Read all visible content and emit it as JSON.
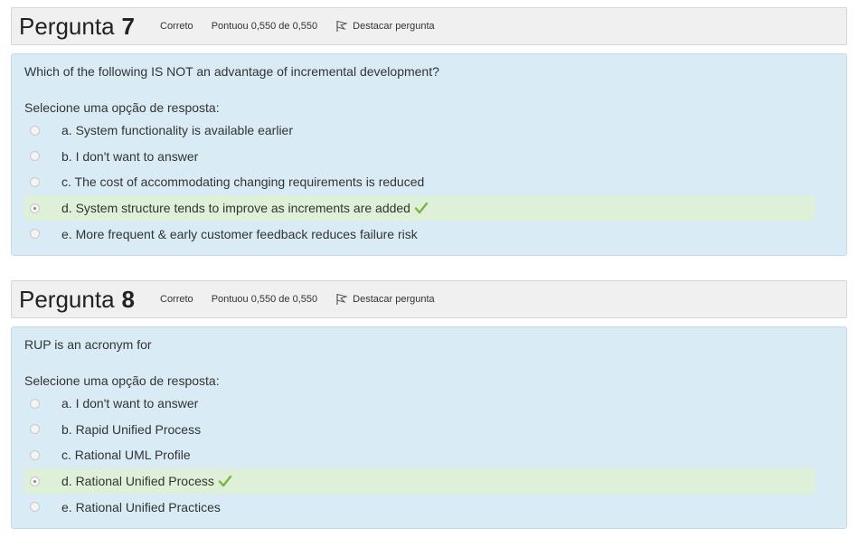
{
  "questions": [
    {
      "title": "Pergunta",
      "number": "7",
      "state": "Correto",
      "grade": "Pontuou 0,550 de 0,550",
      "flag_label": "Destacar pergunta",
      "text": "Which of the following IS NOT an advantage of incremental development?",
      "prompt": "Selecione uma opção de resposta:",
      "answers": [
        {
          "label": "a. System functionality is available earlier",
          "checked": false
        },
        {
          "label": "b. I don't want to answer",
          "checked": false
        },
        {
          "label": "c. The cost of accommodating changing requirements is reduced",
          "checked": false
        },
        {
          "label": "d. System structure tends to improve as increments are added",
          "checked": true
        },
        {
          "label": "e. More frequent & early customer feedback reduces failure risk",
          "checked": false
        }
      ]
    },
    {
      "title": "Pergunta",
      "number": "8",
      "state": "Correto",
      "grade": "Pontuou 0,550 de 0,550",
      "flag_label": "Destacar pergunta",
      "text": "RUP is an acronym for",
      "prompt": "Selecione uma opção de resposta:",
      "answers": [
        {
          "label": "a. I don't want to answer",
          "checked": false
        },
        {
          "label": "b. Rapid Unified Process",
          "checked": false
        },
        {
          "label": "c. Rational UML Profile",
          "checked": false
        },
        {
          "label": "d. Rational Unified Process",
          "checked": true
        },
        {
          "label": "e. Rational Unified Practices",
          "checked": false
        }
      ]
    }
  ],
  "colors": {
    "header_bg": "#f0f0f0",
    "body_bg": "#d9ecf6",
    "correct_bg": "#dff0d8",
    "check": "#7cb342"
  },
  "icons": {
    "flag": "flag-icon",
    "check": "check-icon"
  }
}
